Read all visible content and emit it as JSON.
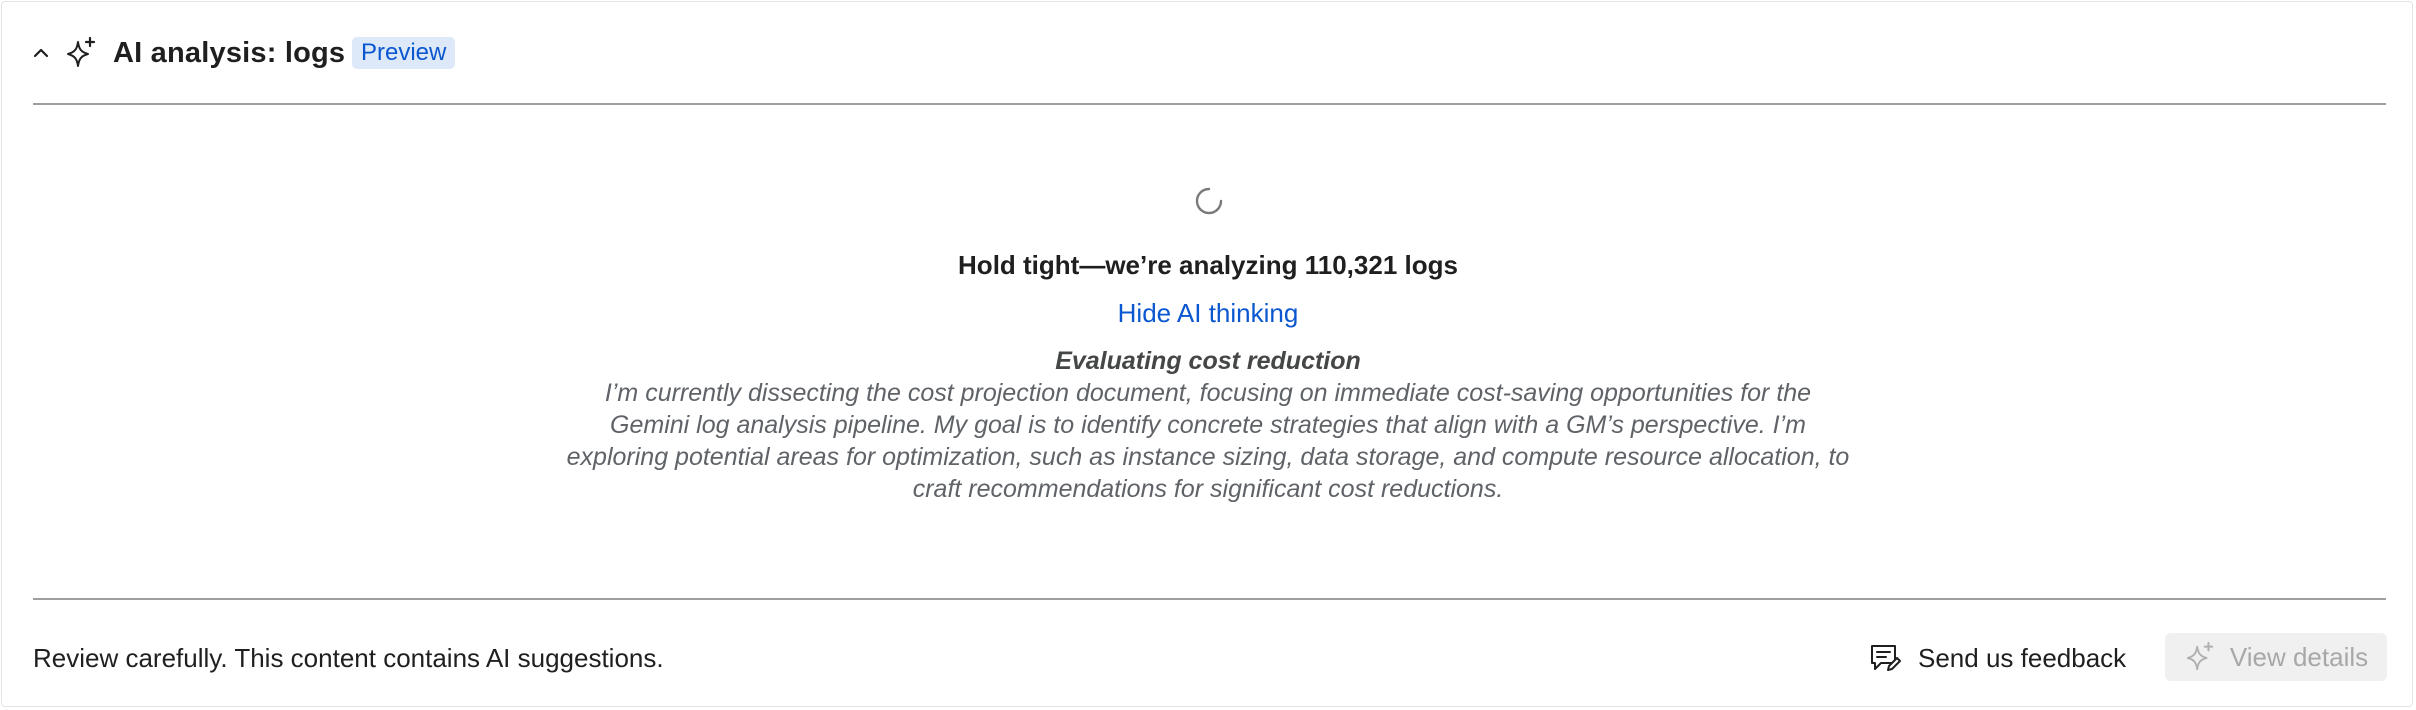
{
  "header": {
    "title": "AI analysis: logs",
    "badge": "Preview",
    "collapse_icon": "chevron-up-icon",
    "title_icon": "sparkle-icon"
  },
  "analysis": {
    "status": "Hold tight—we’re analyzing 110,321 logs",
    "toggle_label": "Hide AI thinking",
    "thinking_title": "Evaluating cost reduction",
    "thinking_text": "I’m currently dissecting the cost projection document, focusing on immediate cost-saving opportunities for the Gemini log analysis pipeline. My goal is to identify concrete strategies that align with a GM’s perspective. I’m exploring potential areas for optimization, such as instance sizing, data storage, and compute resource allocation, to craft recommendations for significant cost reductions.",
    "spinner_icon": "loading-spinner-icon"
  },
  "footer": {
    "disclaimer": "Review carefully. This content contains AI suggestions.",
    "feedback_label": "Send us feedback",
    "feedback_icon": "feedback-icon",
    "details_label": "View details",
    "details_icon": "sparkle-icon",
    "details_disabled": true
  },
  "colors": {
    "link": "#0b57d0",
    "badge_bg": "#dde9f8",
    "divider": "#9e9e9e",
    "disabled_text": "#a8a8a8",
    "disabled_bg": "#f0f0f0"
  }
}
